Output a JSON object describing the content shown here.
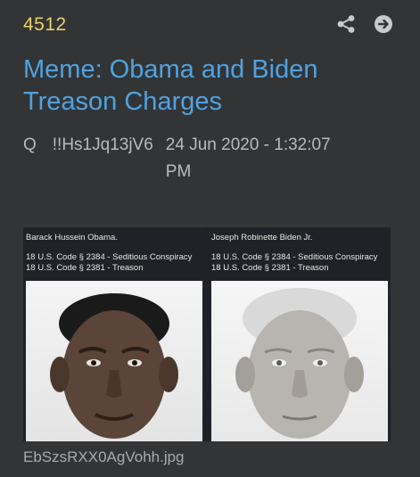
{
  "post": {
    "number": "4512",
    "title": "Meme: Obama and Biden Treason Charges",
    "author": "Q",
    "tripcode": "!!Hs1Jq13jV6",
    "timestamp": "24 Jun 2020 - 1:32:07 PM"
  },
  "actions": {
    "share_icon": "share-icon",
    "open_icon": "arrow-right-circle-icon"
  },
  "image": {
    "filename": "EbSzsRXX0AgVohh.jpg",
    "panels": [
      {
        "name": "Barack Hussein Obama.",
        "codes": [
          "18 U.S. Code § 2384 - Seditious Conspiracy",
          "18 U.S. Code § 2381 - Treason"
        ]
      },
      {
        "name": "Joseph Robinette Biden Jr.",
        "codes": [
          "18 U.S. Code § 2384 - Seditious Conspiracy",
          "18 U.S. Code § 2381 - Treason"
        ]
      }
    ]
  },
  "colors": {
    "background": "#333436",
    "post_number": "#e8d36a",
    "title": "#4fa3e0",
    "meta": "#b9babc"
  }
}
